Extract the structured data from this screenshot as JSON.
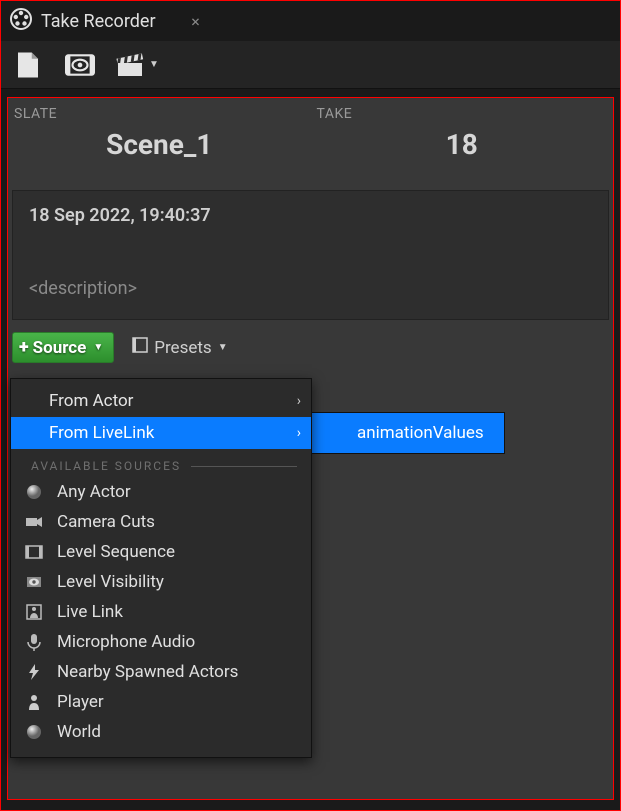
{
  "tab": {
    "title": "Take Recorder"
  },
  "slate": {
    "label": "SLATE",
    "value": "Scene_1"
  },
  "take": {
    "label": "TAKE",
    "value": "18"
  },
  "meta": {
    "timestamp": "18 Sep 2022, 19:40:37",
    "description_placeholder": "<description>"
  },
  "source_button": {
    "label": "Source"
  },
  "presets_button": {
    "label": "Presets"
  },
  "dropdown": {
    "top_items": [
      {
        "label": "From Actor"
      },
      {
        "label": "From LiveLink"
      }
    ],
    "heading": "AVAILABLE SOURCES",
    "sources": [
      {
        "label": "Any Actor",
        "icon": "sphere"
      },
      {
        "label": "Camera Cuts",
        "icon": "camera"
      },
      {
        "label": "Level Sequence",
        "icon": "sequence"
      },
      {
        "label": "Level Visibility",
        "icon": "eye"
      },
      {
        "label": "Live Link",
        "icon": "livelink"
      },
      {
        "label": "Microphone Audio",
        "icon": "mic"
      },
      {
        "label": "Nearby Spawned Actors",
        "icon": "bolt"
      },
      {
        "label": "Player",
        "icon": "pawn"
      },
      {
        "label": "World",
        "icon": "sphere"
      }
    ]
  },
  "submenu": {
    "items": [
      {
        "label": "animationValues"
      }
    ]
  },
  "colors": {
    "highlight": "#0a7cff",
    "green": "#3aa63a",
    "panel": "#383838",
    "border": "#ff0000"
  }
}
